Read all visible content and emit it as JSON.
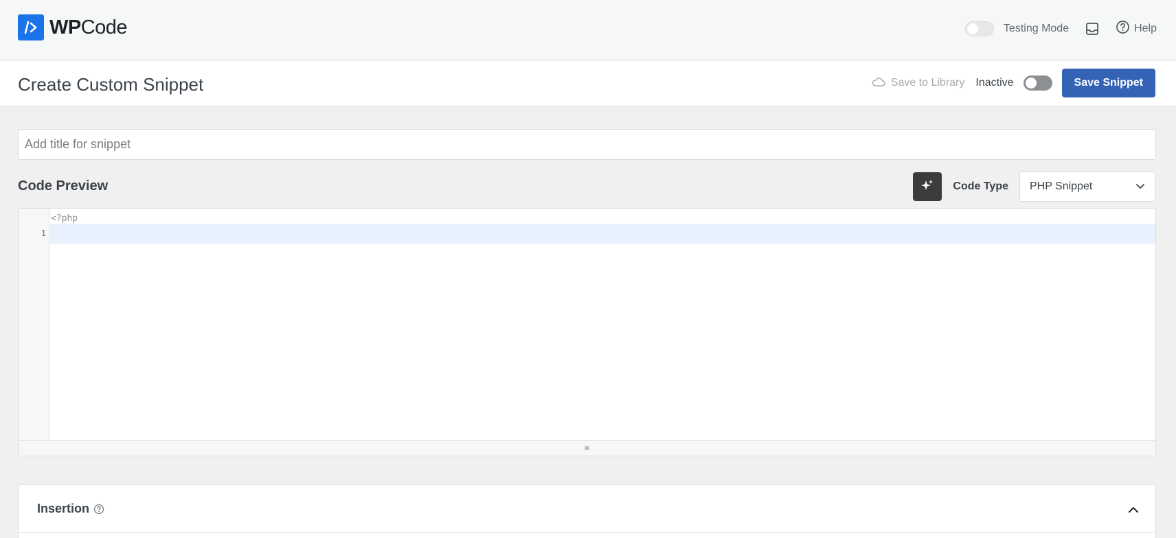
{
  "app": {
    "logo_bold": "WP",
    "logo_light": "Code"
  },
  "topbar": {
    "testing_mode_label": "Testing Mode",
    "help_label": "Help",
    "testing_mode_on": false
  },
  "header": {
    "page_title": "Create Custom Snippet",
    "save_to_library_label": "Save to Library",
    "status_label": "Inactive",
    "save_button_label": "Save Snippet"
  },
  "form": {
    "title_placeholder": "Add title for snippet",
    "title_value": ""
  },
  "code_preview": {
    "section_label": "Code Preview",
    "code_type_label": "Code Type",
    "code_type_value": "PHP Snippet",
    "php_open_tag": "<?php",
    "line_numbers": [
      "1"
    ],
    "resize_handle": "≡"
  },
  "insertion": {
    "title": "Insertion"
  },
  "colors": {
    "accent": "#3463b5",
    "logo_blue": "#1a73e8",
    "active_line": "#e8f2fe",
    "background": "#f0f0f1"
  },
  "icons": [
    "logo-code-icon",
    "inbox-icon",
    "help-circle-icon",
    "cloud-icon",
    "sparkle-icon",
    "chevron-down-icon",
    "chevron-up-icon",
    "question-icon"
  ]
}
